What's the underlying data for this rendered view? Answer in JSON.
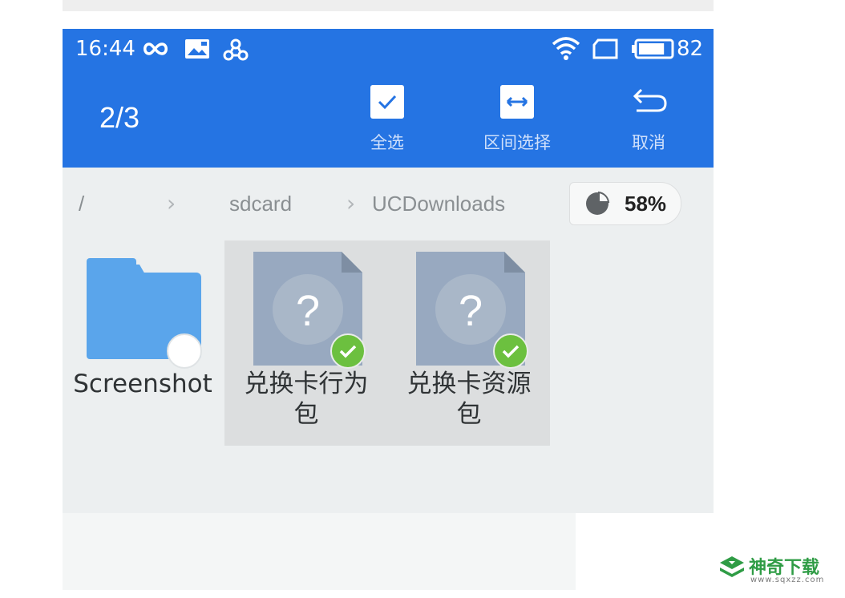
{
  "status_bar": {
    "time": "16:44",
    "battery_percent": "82",
    "icons": [
      "infinity-icon",
      "image-icon",
      "share-icon",
      "wifi-icon",
      "sim-icon",
      "battery-icon"
    ]
  },
  "app_bar": {
    "selection_count": "2/3",
    "actions": [
      {
        "label": "全选",
        "icon": "checkbox-icon"
      },
      {
        "label": "区间选择",
        "icon": "range-select-icon"
      },
      {
        "label": "取消",
        "icon": "undo-arrow-icon"
      }
    ]
  },
  "breadcrumb": {
    "root": "/",
    "items": [
      "sdcard",
      "UCDownloads"
    ],
    "separator": ">"
  },
  "storage": {
    "percent_label": "58%",
    "used_fraction": 0.58
  },
  "files": [
    {
      "name": "Screenshot",
      "type": "folder",
      "selected": false
    },
    {
      "name": "兑换卡行为包",
      "type": "unknown-file",
      "selected": true
    },
    {
      "name": "兑换卡资源包",
      "type": "unknown-file",
      "selected": true
    }
  ],
  "watermark": {
    "brand": "神奇下载",
    "url": "www.sqxzz.com"
  },
  "colors": {
    "accent": "#2574e3",
    "folder": "#5aa5eb",
    "check": "#6cc03f",
    "file_icon": "#98a9c0"
  }
}
